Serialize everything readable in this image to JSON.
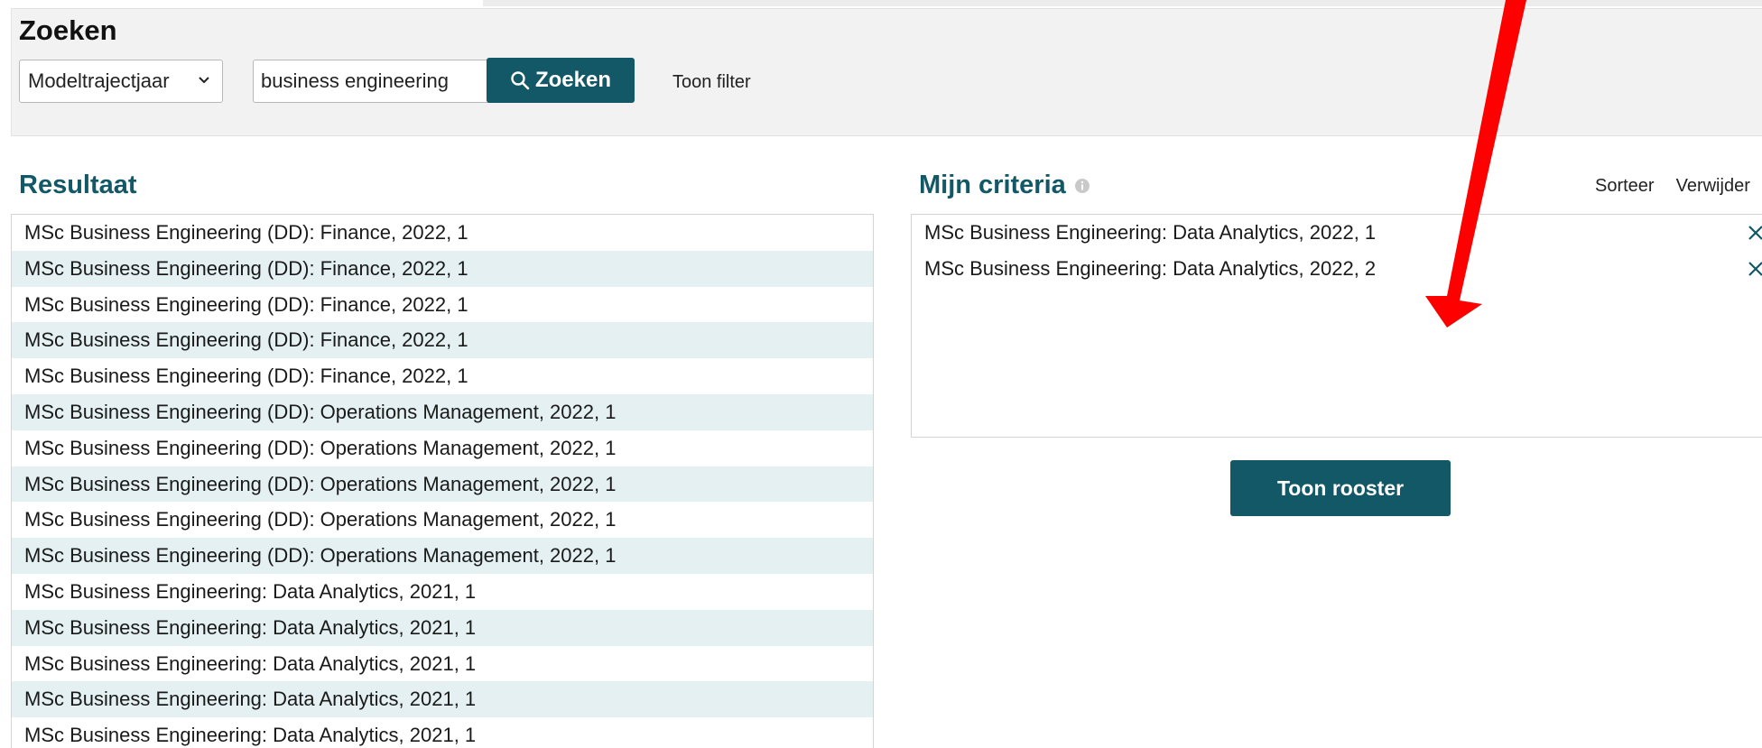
{
  "search": {
    "title": "Zoeken",
    "select_value": "Modeltrajectjaar",
    "input_value": "business engineering",
    "button_label": "Zoeken",
    "toggle_filter_label": "Toon filter"
  },
  "results": {
    "title": "Resultaat",
    "rows": [
      "MSc Business Engineering (DD): Finance, 2022, 1",
      "MSc Business Engineering (DD): Finance, 2022, 1",
      "MSc Business Engineering (DD): Finance, 2022, 1",
      "MSc Business Engineering (DD): Finance, 2022, 1",
      "MSc Business Engineering (DD): Finance, 2022, 1",
      "MSc Business Engineering (DD): Operations Management, 2022, 1",
      "MSc Business Engineering (DD): Operations Management, 2022, 1",
      "MSc Business Engineering (DD): Operations Management, 2022, 1",
      "MSc Business Engineering (DD): Operations Management, 2022, 1",
      "MSc Business Engineering (DD): Operations Management, 2022, 1",
      "MSc Business Engineering: Data Analytics, 2021, 1",
      "MSc Business Engineering: Data Analytics, 2021, 1",
      "MSc Business Engineering: Data Analytics, 2021, 1",
      "MSc Business Engineering: Data Analytics, 2021, 1",
      "MSc Business Engineering: Data Analytics, 2021, 1"
    ]
  },
  "criteria": {
    "title": "Mijn criteria",
    "info_icon": "info-icon",
    "sort_label": "Sorteer",
    "remove_all_label": "Verwijder",
    "items": [
      "MSc Business Engineering: Data Analytics, 2022, 1",
      "MSc Business Engineering: Data Analytics, 2022, 2"
    ],
    "show_button_label": "Toon rooster"
  },
  "colors": {
    "accent": "#135866",
    "row_stripe": "#e4f0f1",
    "arrow": "#ff0000"
  }
}
